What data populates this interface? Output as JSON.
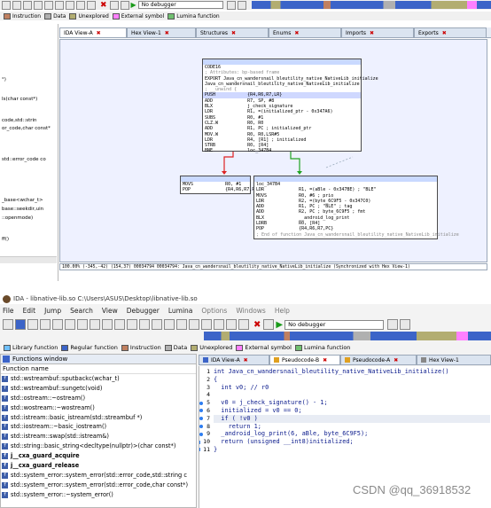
{
  "top": {
    "debugger": "No debugger",
    "legend": [
      {
        "label": "Instruction",
        "color": "#c08060"
      },
      {
        "label": "Data",
        "color": "#b0b0b0"
      },
      {
        "label": "Unexplored",
        "color": "#b2ad71"
      },
      {
        "label": "External symbol",
        "color": "#ff80ff"
      },
      {
        "label": "Lumina function",
        "color": "#70c070"
      }
    ],
    "tabs": [
      {
        "label": "IDA View-A",
        "closable": true
      },
      {
        "label": "Hex View-1",
        "closable": true
      },
      {
        "label": "Structures",
        "closable": true
      },
      {
        "label": "Enums",
        "closable": true
      },
      {
        "label": "Imports",
        "closable": true
      },
      {
        "label": "Exports",
        "closable": true
      }
    ],
    "left_fragments": [
      "°)",
      "Is(char const*)",
      "code,std::strin",
      "or_code,char const*",
      "std::error_code co",
      "_base<wchar_t>",
      "base::seekdir,uin",
      "::openmode)",
      "ff()"
    ],
    "nodes": {
      "main": [
        "CODE16",
        "",
        "",
        "; Attributes: bp-based frame",
        "",
        "EXPORT Java_cn_wandersnail_bleutility_native_NativeLib_initialize",
        "Java_cn_wandersnail_bleutility_native_NativeLib_initialize",
        "; __unwind {",
        "PUSH            {R4,R6,R7,LR}",
        "ADD             R7, SP, #8",
        "BLX             j_check_signature",
        "LDR             R1, =(initialized_ptr - 0x347A6)",
        "SUBS            R0, #1",
        "CLZ.W           R0, R0",
        "ADD             R1, PC ; initialized_ptr",
        "MOV.W           R0, R0,LSR#5",
        "LDR             R4, [R1] ; initialized",
        "STRB            R0, [R4]",
        "BNE             loc_347B4"
      ],
      "left": [
        "MOVS            R0, #1",
        "POP             {R4,R6,R7,PC}"
      ],
      "right": [
        "loc_347B4",
        "LDR             R1, =(aBle - 0x347BE) ; \"BLE\"",
        "MOVS            R0, #6 ; prio",
        "LDR             R2, =(byte_6C9F5 - 0x347C0)",
        "ADD             R1, PC ; \"BLE\" ; tag",
        "ADD             R2, PC ; byte_6C9F5 ; fmt",
        "BLX             __android_log_print",
        "LDRB            R0, [R4]",
        "POP             {R4,R6,R7,PC}",
        "; End of function Java_cn_wandersnail_bleutility_native_NativeLib_initialize"
      ]
    },
    "status": "100.00% (-345,-42) (154,37) 00034794 00034794: Java_cn_wandersnail_bleutility_native_NativeLib_initialize (Synchronized with Hex View-1)"
  },
  "bottom": {
    "title": "IDA - libnative-lib.so C:\\Users\\ASUS\\Desktop\\libnative-lib.so",
    "menu": [
      "File",
      "Edit",
      "Jump",
      "Search",
      "View",
      "Debugger",
      "Lumina",
      "Options",
      "Windows",
      "Help"
    ],
    "debugger": "No debugger",
    "legend": [
      {
        "label": "Library function",
        "color": "#70c0ff"
      },
      {
        "label": "Regular function",
        "color": "#3c64c8"
      },
      {
        "label": "Instruction",
        "color": "#c08060"
      },
      {
        "label": "Data",
        "color": "#b0b0b0"
      },
      {
        "label": "Unexplored",
        "color": "#b2ad71"
      },
      {
        "label": "External symbol",
        "color": "#ff80ff"
      },
      {
        "label": "Lumina function",
        "color": "#70c070"
      }
    ],
    "functions_window": {
      "title": "Functions window",
      "column": "Function name",
      "items": [
        {
          "name": "std::wstreambuf::sputbackc(wchar_t)",
          "bold": false
        },
        {
          "name": "std::wstreambuf::sungetc(void)",
          "bold": false
        },
        {
          "name": "std::ostream::~ostream()",
          "bold": false
        },
        {
          "name": "std::wostream::~wostream()",
          "bold": false
        },
        {
          "name": "std::istream::basic_istream(std::streambuf *)",
          "bold": false
        },
        {
          "name": "std::iostream::~basic_iostream()",
          "bold": false
        },
        {
          "name": "std::istream::swap(std::istream&)",
          "bold": false
        },
        {
          "name": "std::string::basic_string<decltype(nullptr)>(char const*)",
          "bold": false
        },
        {
          "name": "j__cxa_guard_acquire",
          "bold": true
        },
        {
          "name": "j__cxa_guard_release",
          "bold": true
        },
        {
          "name": "std::system_error::system_error(std::error_code,std::string c",
          "bold": false
        },
        {
          "name": "std::system_error::system_error(std::error_code,char const*)",
          "bold": false
        },
        {
          "name": "std::system_error::~system_error()",
          "bold": false
        }
      ]
    },
    "tabs": [
      {
        "label": "IDA View-A"
      },
      {
        "label": "Pseudocode-B"
      },
      {
        "label": "Pseudocode-A"
      },
      {
        "label": "Hex View-1"
      }
    ],
    "code": [
      {
        "n": "1",
        "dot": false,
        "text": "int Java_cn_wandersnail_bleutility_native_NativeLib_initialize()"
      },
      {
        "n": "2",
        "dot": false,
        "text": "{"
      },
      {
        "n": "3",
        "dot": false,
        "text": "  int v0; // r0"
      },
      {
        "n": "4",
        "dot": false,
        "text": ""
      },
      {
        "n": "5",
        "dot": true,
        "text": "  v0 = j_check_signature() - 1;"
      },
      {
        "n": "6",
        "dot": true,
        "text": "  initialized = v0 == 0;"
      },
      {
        "n": "7",
        "dot": true,
        "text": "  if ( !v0 )"
      },
      {
        "n": "8",
        "dot": true,
        "text": "    return 1;"
      },
      {
        "n": "9",
        "dot": true,
        "text": "  _android_log_print(6, aBle, byte_6C9F5);"
      },
      {
        "n": "10",
        "dot": true,
        "text": "  return (unsigned __int8)initialized;"
      },
      {
        "n": "11",
        "dot": true,
        "text": "}"
      }
    ]
  },
  "watermark": "CSDN @qq_36918532"
}
